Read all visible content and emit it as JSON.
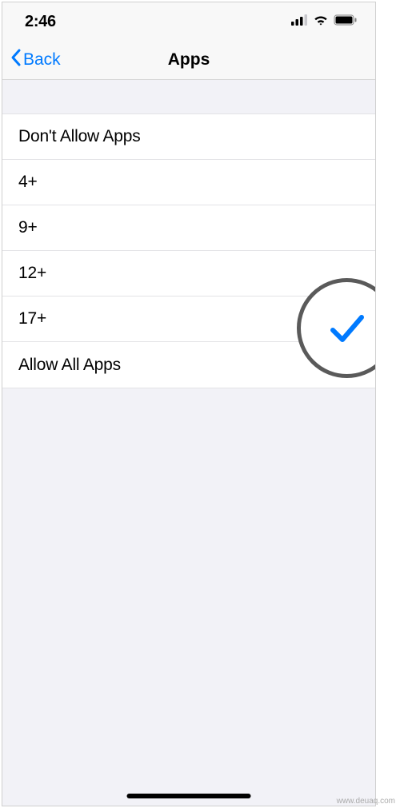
{
  "status": {
    "time": "2:46"
  },
  "nav": {
    "back_label": "Back",
    "title": "Apps"
  },
  "options": [
    {
      "label": "Don't Allow Apps",
      "selected": false
    },
    {
      "label": "4+",
      "selected": false
    },
    {
      "label": "9+",
      "selected": false
    },
    {
      "label": "12+",
      "selected": false
    },
    {
      "label": "17+",
      "selected": true
    },
    {
      "label": "Allow All Apps",
      "selected": false
    }
  ],
  "watermark": "www.deuaq.com"
}
